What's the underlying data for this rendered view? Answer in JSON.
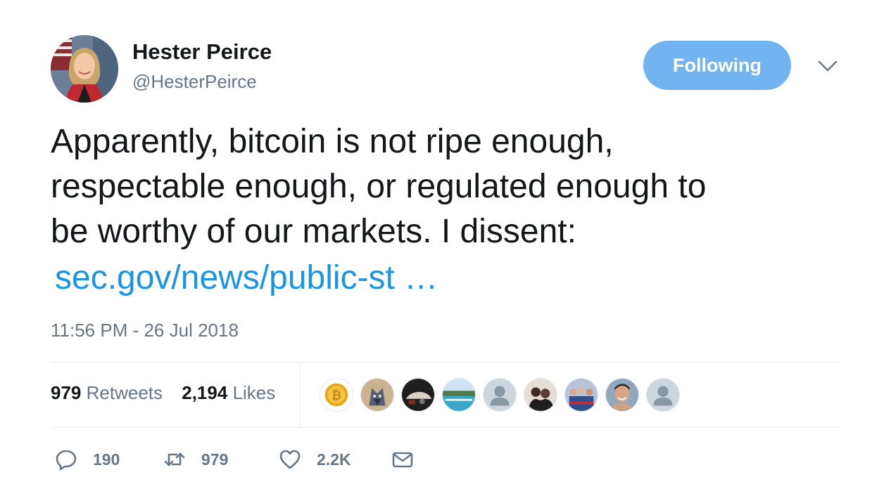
{
  "author": {
    "name": "Hester Peirce",
    "handle": "@HesterPeirce"
  },
  "follow_button": {
    "label": "Following",
    "color": "#71b4ef"
  },
  "tweet": {
    "lines": [
      "Apparently, bitcoin is not ripe enough,",
      "respectable enough, or regulated enough to",
      "be worthy of our markets. I dissent:"
    ],
    "link_text": "sec.gov/news/public-st …",
    "timestamp": "11:56 PM - 26 Jul 2018"
  },
  "stats": {
    "retweets_count": "979",
    "retweets_label": "Retweets",
    "likes_count": "2,194",
    "likes_label": "Likes"
  },
  "liker_avatars": [
    "bitcoin-coin",
    "wolf-warrior",
    "car-photo",
    "pool-landscape",
    "default-user",
    "couple-photo",
    "group-photo",
    "smiling-man",
    "default-user"
  ],
  "actions": {
    "reply_count": "190",
    "retweet_count": "979",
    "like_count": "2.2K"
  },
  "colors": {
    "link": "#1b95e0",
    "secondary_text": "#657786",
    "divider": "#e6ecf0"
  }
}
